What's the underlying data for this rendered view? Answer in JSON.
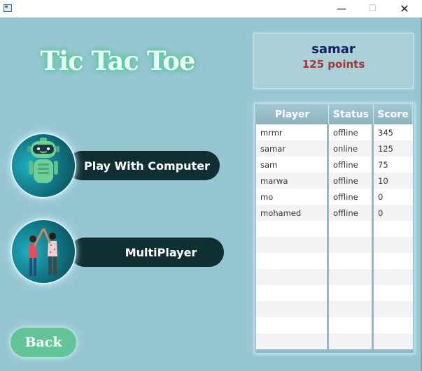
{
  "window": {
    "min_glyph": "—",
    "max_glyph": "☐",
    "close_glyph": "✕"
  },
  "title": "Tic Tac Toe",
  "menu": {
    "computer_label": "Play With Computer",
    "computer_icon": "robot-icon",
    "multi_label": "MultiPlayer",
    "multi_icon": "two-players-icon",
    "back_label": "Back"
  },
  "player": {
    "name": "samar",
    "points": "125 points"
  },
  "table": {
    "columns": [
      "Player",
      "Status",
      "Score"
    ],
    "rows": [
      [
        "mrmr",
        "offline",
        "345"
      ],
      [
        "samar",
        "online",
        "125"
      ],
      [
        "sam",
        "offline",
        "75"
      ],
      [
        "marwa",
        "offline",
        "10"
      ],
      [
        "mo",
        "offline",
        "0"
      ],
      [
        "mohamed",
        "offline",
        "0"
      ],
      [
        "",
        "",
        ""
      ],
      [
        "",
        "",
        ""
      ],
      [
        "",
        "",
        ""
      ],
      [
        "",
        "",
        ""
      ],
      [
        "",
        "",
        ""
      ],
      [
        "",
        "",
        ""
      ],
      [
        "",
        "",
        ""
      ],
      [
        "",
        "",
        ""
      ]
    ]
  },
  "colors": {
    "background": "#97c6d3",
    "button_dark": "#0f2f33",
    "back_button": "#62c498",
    "title_glow": "#4ac894",
    "name_color": "#10205a",
    "points_color": "#a4343a"
  }
}
